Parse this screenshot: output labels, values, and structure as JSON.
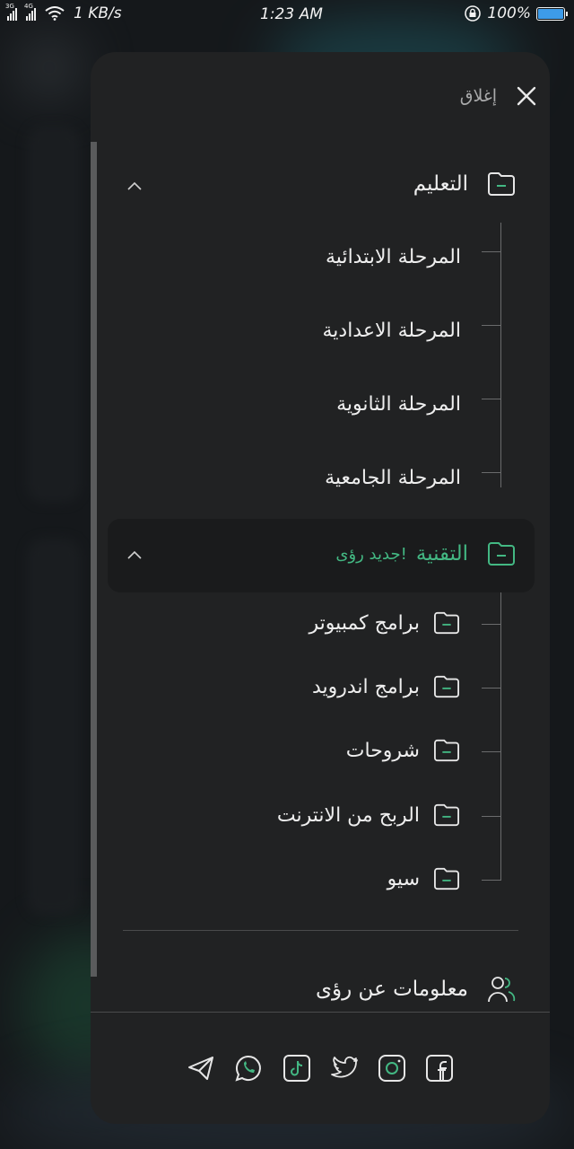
{
  "status_bar": {
    "signal1_label": "3G",
    "signal2_label": "4G",
    "speed": "1 KB/s",
    "time": "1:23 AM",
    "battery": "100%",
    "battery_level": 1.0
  },
  "drawer": {
    "close_label": "إغلاق",
    "categories": [
      {
        "label": "التعليم",
        "expanded": true,
        "subitems": [
          "المرحلة الابتدائية",
          "المرحلة الاعدادية",
          "المرحلة الثانوية",
          "المرحلة الجامعية"
        ]
      },
      {
        "label": "التقنية",
        "badge": "جديد رؤى!",
        "expanded": true,
        "active": true,
        "subitems": [
          "برامج كمبيوتر",
          "برامج اندرويد",
          "شروحات",
          "الربح من الانترنت",
          "سيو"
        ]
      }
    ],
    "about_label": "معلومات عن رؤى"
  },
  "social_icons": [
    "telegram-icon",
    "whatsapp-icon",
    "tiktok-icon",
    "twitter-icon",
    "instagram-icon",
    "facebook-icon"
  ],
  "colors": {
    "accent": "#43b883",
    "panel": "#212223"
  }
}
